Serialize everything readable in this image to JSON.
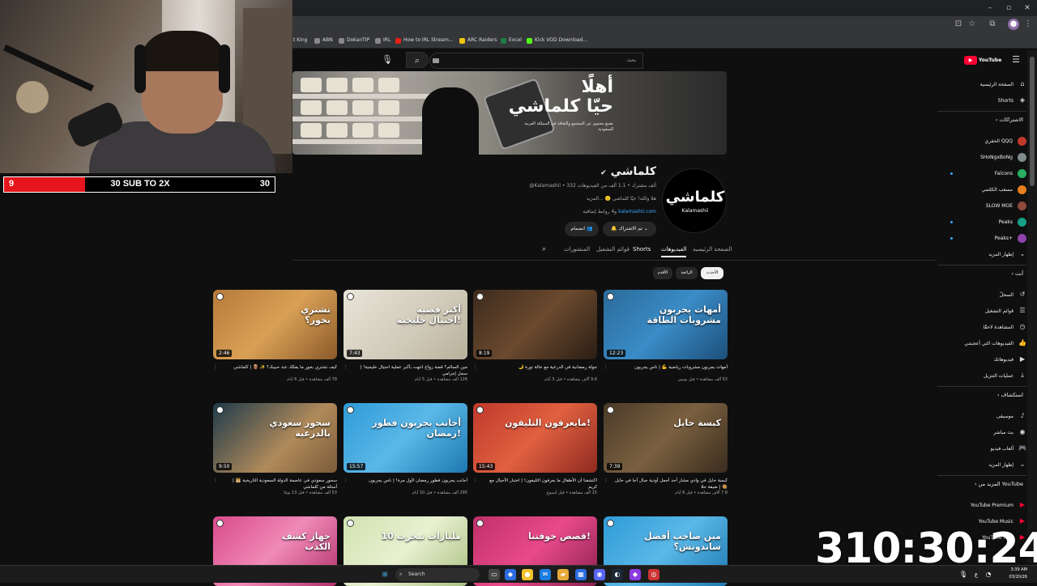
{
  "browser": {
    "window_controls": {
      "minimize": "–",
      "restore": "▫",
      "close": "✕"
    },
    "bookmarks": [
      "t King",
      "ABN",
      "DokanTIP",
      "IRL",
      "How to IRL Stream...",
      "ARC Raiders",
      "Excel",
      "Kick VOD Download..."
    ]
  },
  "overlay": {
    "sub_goal_left": "9",
    "sub_goal_label": "30 SUB TO 2X",
    "sub_goal_right": "30",
    "sub_goal_progress": 0.3,
    "timer": "310:30:24"
  },
  "header": {
    "search_placeholder": "بحث",
    "logo_text": "YouTube"
  },
  "banner": {
    "headline_1": "أهلًا",
    "headline_2": "حيّا كلماشي",
    "description": "نصنع محتوى عن المجتمع والثقافة في المملكة العربية السعودية"
  },
  "channel": {
    "avatar_text": "كلماشي",
    "avatar_sub": "Kalamashii",
    "name": "كلماشي",
    "handle": "@Kalamashii",
    "meta": "‎@Kalamashii • 332 ألف مشترك • 1.1 ألف من الفيديوهات",
    "description": "هلا والله! حيّا كلماشي 🙂 ...المزيد",
    "link": "kalamashii.com",
    "link_suffix": "و4 روابط إضافية",
    "subscribed_label": "تم الاشتراك",
    "join_label": "انضمام"
  },
  "tabs": [
    "الصفحة الرئيسية",
    "الفيديوهات",
    "Shorts",
    "قوائم التشغيل",
    "المنشورات"
  ],
  "active_tab": "الفيديوهات",
  "chips": [
    "الأحدث",
    "الرائجة",
    "الأقدم"
  ],
  "videos": [
    {
      "thumb_text": "أمهات يجربون\nمشروبات الطاقة",
      "duration": "12:23",
      "title": "أمهات يجربون مشروبات رياضية 💪 | ناس يجربون",
      "meta": "53 ألف مشاهدة • قبل يومين",
      "bg": "linear-gradient(135deg,#2b6b9a,#3a8cc7 50%,#1c4f7a)"
    },
    {
      "thumb_text": "",
      "duration": "8:19",
      "title": "جولة رمضانية في الدرعية مع خالة نورة 🌙",
      "meta": "9.6 آلاف مشاهدة • قبل 3 أيام",
      "bg": "linear-gradient(135deg,#3d2a1d,#6b4a2e 50%,#2a1d14)"
    },
    {
      "thumb_text": "أكبر قضية\nاحتيال خليجية!",
      "duration": "7:43",
      "title": "مين السالم؟ قصة زواج انتهت بأكبر عملية احتيال خليجية! | سجل إجرامي",
      "meta": "126 ألف مشاهدة • قبل 5 أيام",
      "bg": "linear-gradient(135deg,#e8e4d8,#cfc9b8 60%,#b8b09a)"
    },
    {
      "thumb_text": "تشتري\nبخور؟",
      "duration": "2:46",
      "title": "كيف تشتري بخور ما يفكك عند حبيبك؟ ✨ 🪵 | كلماشي",
      "meta": "79 ألف مشاهدة • قبل 6 أيام",
      "bg": "linear-gradient(135deg,#b57a3a,#d9a055 50%,#8a5a2a)"
    },
    {
      "thumb_text": "كبسة حايل",
      "duration": "7:39",
      "title": "كبسة حايل في وادي مشار أحد أجمل أودية جبال أجا في حايل 🥘 | ضيفة حلا",
      "meta": "7.8 آلاف مشاهدة • قبل 6 أيام",
      "bg": "linear-gradient(135deg,#4a3a28,#7a6040 50%,#3a2c1e)"
    },
    {
      "thumb_text": "مايعرفون التليفون!",
      "duration": "15:43",
      "title": "اكتشفنا أن الأطفال ما يعرفون التليفون! | اختبار الأجيال مع كريم",
      "meta": "15 ألف مشاهدة • قبل أسبوع",
      "bg": "linear-gradient(135deg,#c0392b,#e06040 50%,#8e2a20)"
    },
    {
      "thumb_text": "أجانب يجربون فطور رمضان!",
      "duration": "15:57",
      "title": "أجانب يجربون فطور رمضان لأول مرة! | ناس يجربون",
      "meta": "295 ألف مشاهدة • قبل 10 أيام",
      "bg": "linear-gradient(135deg,#2f9bd6,#5ab8e8 50%,#1e78b0)"
    },
    {
      "thumb_text": "سحور سعودي\nبالدرعية",
      "duration": "9:50",
      "title": "سحور سعودي في عاصمة الدولة السعودية التاريخية 🕌 | أسئلة من كلماشي",
      "meta": "53 ألف مشاهدة • قبل 13 يومًا",
      "bg": "linear-gradient(135deg,#1e3a4a,#b08a5a 60%,#7a5a3a)"
    },
    {
      "thumb_text": "مين صاحب أفضل ساندوتش؟",
      "duration": "",
      "title": "",
      "meta": "",
      "bg": "linear-gradient(135deg,#2f9bd6,#5ab8e8 50%,#1e78b0)"
    },
    {
      "thumb_text": "قصص خوفتنا!",
      "duration": "",
      "title": "",
      "meta": "",
      "bg": "linear-gradient(135deg,#c0306a,#e84a8a 50%,#8a2050)"
    },
    {
      "thumb_text": "10 مليارات تبخرت",
      "duration": "",
      "title": "",
      "meta": "",
      "bg": "linear-gradient(135deg,#cfe3b0,#e8f0d0 50%,#a8c080)"
    },
    {
      "thumb_text": "جهاز كشف\nالكذب",
      "duration": "",
      "title": "",
      "meta": "",
      "bg": "linear-gradient(135deg,#d84a8a,#f08ab8 50%,#b0306a)"
    }
  ],
  "sidebar": {
    "main": [
      {
        "label": "الصفحة الرئيسية",
        "icon": "home-icon",
        "glyph": "⌂"
      },
      {
        "label": "Shorts",
        "icon": "shorts-icon",
        "glyph": "◈"
      }
    ],
    "subscriptions_title": "الاشتراكات",
    "subscriptions": [
      {
        "label": "الحقري QQQ",
        "color": "#c0392b",
        "dot": false
      },
      {
        "label": "SHoNgxBoNg",
        "color": "#7f8c8d",
        "dot": false
      },
      {
        "label": "Falcons",
        "color": "#27ae60",
        "dot": true
      },
      {
        "label": "مسعب الكلثمي",
        "color": "#e67e22",
        "dot": false
      },
      {
        "label": "SLOW MOE",
        "color": "#8e4a3a",
        "dot": false
      },
      {
        "label": "Peaks",
        "color": "#16a085",
        "dot": true
      },
      {
        "label": "Peaks+",
        "color": "#8e44ad",
        "dot": true
      }
    ],
    "show_more": "إظهار المزيد",
    "you_title": "أنت",
    "you": [
      {
        "label": "السجلّ",
        "glyph": "↺"
      },
      {
        "label": "قوائم التشغيل",
        "glyph": "☰"
      },
      {
        "label": "المشاهدة لاحقًا",
        "glyph": "◷"
      },
      {
        "label": "الفيديوهات التي أعجبتني",
        "glyph": "👍"
      },
      {
        "label": "فيديوهاتك",
        "glyph": "▶"
      },
      {
        "label": "عمليات التنزيل",
        "glyph": "⤓"
      }
    ],
    "explore_title": "استكشاف",
    "explore": [
      {
        "label": "موسيقى",
        "glyph": "♪"
      },
      {
        "label": "بث مباشر",
        "glyph": "◉"
      },
      {
        "label": "ألعاب فيديو",
        "glyph": "🎮"
      }
    ],
    "more_from_title": "المزيد من YouTube",
    "more_from": [
      {
        "label": "YouTube Premium",
        "glyph": "▶"
      },
      {
        "label": "YouTube Music",
        "glyph": "▶"
      },
      {
        "label": "YouTube Kids",
        "glyph": "▶"
      }
    ]
  },
  "taskbar": {
    "search_label": "Search",
    "time": "3:39 AM",
    "date": "03/20/26"
  }
}
